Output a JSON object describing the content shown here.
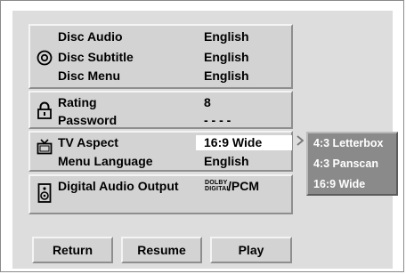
{
  "menu": {
    "disc": {
      "icon": "disc-icon",
      "items": [
        {
          "label": "Disc Audio",
          "value": "English"
        },
        {
          "label": "Disc Subtitle",
          "value": "English"
        },
        {
          "label": "Disc Menu",
          "value": "English"
        }
      ]
    },
    "lock": {
      "icon": "padlock-icon",
      "items": [
        {
          "label": "Rating",
          "value": "8"
        },
        {
          "label": "Password",
          "value": "- - - -"
        }
      ]
    },
    "display": {
      "icon": "tv-icon",
      "items": [
        {
          "label": "TV Aspect",
          "value": "16:9 Wide"
        },
        {
          "label": "Menu Language",
          "value": "English"
        }
      ]
    },
    "audio": {
      "icon": "speaker-icon",
      "label": "Digital Audio Output",
      "dolby_line1": "DOLBY",
      "dolby_line2": "DIGITAL",
      "value_suffix": "/PCM"
    }
  },
  "aspect_options": [
    "4:3 Letterbox",
    "4:3 Panscan",
    "16:9 Wide"
  ],
  "buttons": {
    "return": "Return",
    "resume": "Resume",
    "play": "Play"
  },
  "colors": {
    "frame": "#dddddd",
    "panel": "#d3d3d3",
    "options_bg": "#8a8a8a",
    "selected_bg": "#ffffff"
  }
}
